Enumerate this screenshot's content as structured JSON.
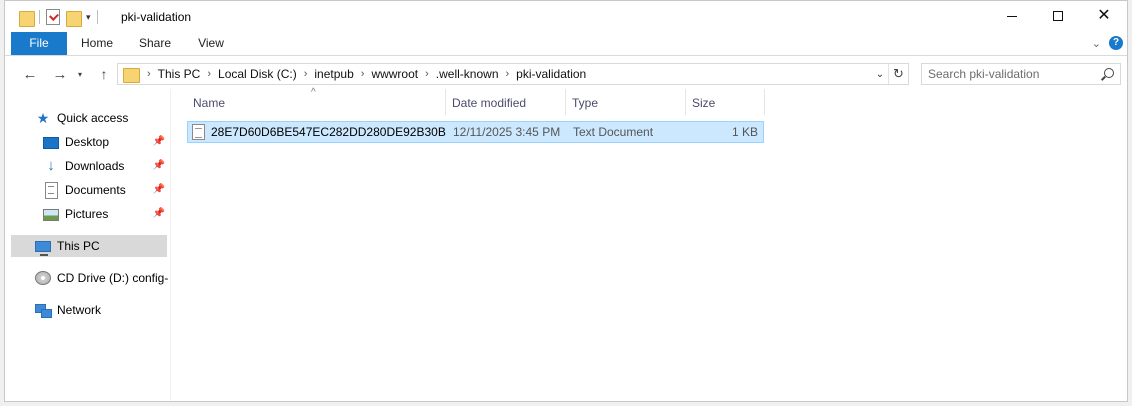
{
  "window": {
    "title": "pki-validation",
    "close_glyph": "✕"
  },
  "ribbon": {
    "tabs": [
      "File",
      "Home",
      "Share",
      "View"
    ],
    "help_glyph": "?",
    "collapse_glyph": "⌄",
    "accent_color": "#1979ca"
  },
  "navigation": {
    "back_glyph": "←",
    "forward_glyph": "→",
    "recent_glyph": "▾",
    "up_glyph": "↑"
  },
  "address": {
    "breadcrumbs": [
      "This PC",
      "Local Disk (C:)",
      "inetpub",
      "wwwroot",
      ".well-known",
      "pki-validation"
    ],
    "separator": "›",
    "dropdown_glyph": "⌄",
    "refresh_glyph": "↻"
  },
  "search": {
    "placeholder": "Search pki-validation"
  },
  "nav_pane": {
    "items": [
      {
        "label": "Quick access",
        "icon": "star-icon"
      },
      {
        "label": "Desktop",
        "icon": "desktop-icon",
        "pinned": true
      },
      {
        "label": "Downloads",
        "icon": "downloads-icon",
        "pinned": true
      },
      {
        "label": "Documents",
        "icon": "documents-icon",
        "pinned": true
      },
      {
        "label": "Pictures",
        "icon": "pictures-icon",
        "pinned": true
      },
      {
        "label": "This PC",
        "icon": "computer-icon",
        "selected": true
      },
      {
        "label": "CD Drive (D:) config-",
        "icon": "cd-drive-icon"
      },
      {
        "label": "Network",
        "icon": "network-icon"
      }
    ],
    "pin_glyph": "📌"
  },
  "file_list": {
    "columns": [
      "Name",
      "Date modified",
      "Type",
      "Size"
    ],
    "sort_glyph": "^",
    "rows": [
      {
        "name": "28E7D60D6BE547EC282DD280DE92B30B",
        "date_modified": "12/11/2025 3:45 PM",
        "type": "Text Document",
        "size": "1 KB",
        "selected": true
      }
    ],
    "selection_color": "#cce8ff"
  }
}
